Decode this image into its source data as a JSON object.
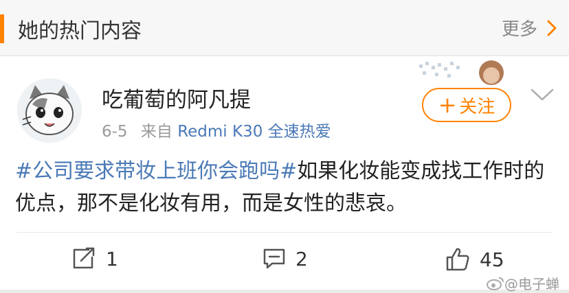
{
  "header": {
    "title": "她的热门内容",
    "more_label": "更多"
  },
  "post": {
    "username": "吃葡萄的阿凡提",
    "date": "6-5",
    "source_prefix": "来自",
    "device": "Redmi K30 全速热爱",
    "follow_plus": "+",
    "follow_label": "关注",
    "content": {
      "hashtag": "#公司要求带妆上班你会跑吗#",
      "text": "如果化妆能变成找工作时的优点，那不是化妆有用，而是女性的悲哀。"
    }
  },
  "actions": {
    "repost_count": "1",
    "comment_count": "2",
    "like_count": "45"
  },
  "watermark": {
    "text": "@电子蝉"
  },
  "colors": {
    "accent": "#ff8200",
    "link": "#4a79b6"
  },
  "icons": [
    "chevron-right-icon",
    "chevron-down-icon",
    "repost-icon",
    "comment-icon",
    "like-icon",
    "weibo-logo-icon"
  ]
}
